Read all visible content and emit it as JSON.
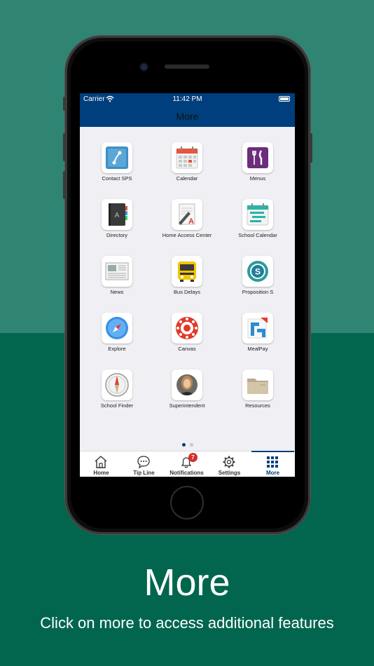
{
  "status": {
    "carrier": "Carrier",
    "time": "11:42 PM"
  },
  "nav": {
    "title": "More"
  },
  "items": [
    {
      "label": "Contact SPS",
      "icon": "contact-icon"
    },
    {
      "label": "Calendar",
      "icon": "calendar-icon"
    },
    {
      "label": "Menus",
      "icon": "menus-icon"
    },
    {
      "label": "Directory",
      "icon": "directory-icon"
    },
    {
      "label": "Home Access Center",
      "icon": "home-access-icon"
    },
    {
      "label": "School Calendar",
      "icon": "school-calendar-icon"
    },
    {
      "label": "News",
      "icon": "news-icon"
    },
    {
      "label": "Bus Delays",
      "icon": "bus-icon"
    },
    {
      "label": "Proposition S",
      "icon": "proposition-s-icon"
    },
    {
      "label": "Explore",
      "icon": "compass-icon"
    },
    {
      "label": "Canvas",
      "icon": "canvas-icon"
    },
    {
      "label": "MealPay",
      "icon": "mealpay-icon"
    },
    {
      "label": "School Finder",
      "icon": "school-finder-icon"
    },
    {
      "label": "Superintendent",
      "icon": "superintendent-photo"
    },
    {
      "label": "Resources",
      "icon": "folder-icon"
    }
  ],
  "pager": {
    "total": 2,
    "current": 1
  },
  "tabs": [
    {
      "label": "Home",
      "icon": "home-icon"
    },
    {
      "label": "Tip Line",
      "icon": "chat-icon"
    },
    {
      "label": "Notifications",
      "icon": "bell-icon",
      "badge": "7"
    },
    {
      "label": "Settings",
      "icon": "gear-icon"
    },
    {
      "label": "More",
      "icon": "grid-icon",
      "active": true
    }
  ],
  "promo": {
    "headline": "More",
    "subhead": "Click on more to access additional features"
  },
  "colors": {
    "brand": "#003f7d",
    "bg_top": "#2f8472",
    "bg_bottom": "#02664f",
    "badge": "#d32f2f"
  }
}
